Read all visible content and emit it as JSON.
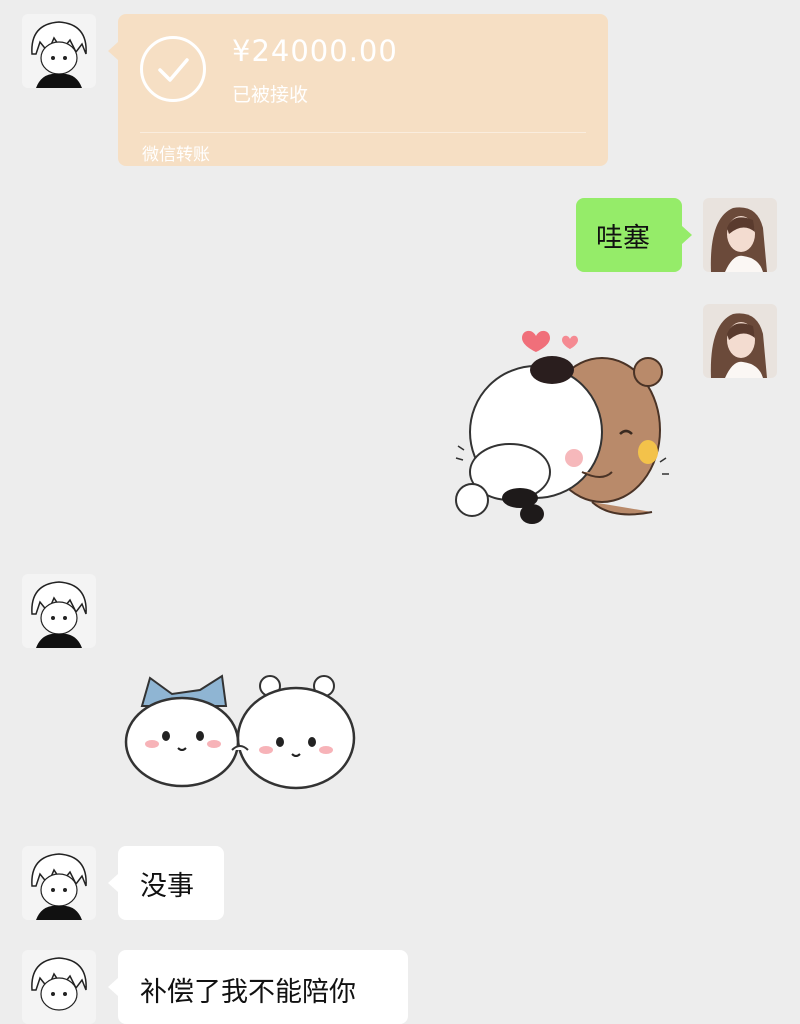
{
  "chat": {
    "messages": [
      {
        "sender": "other",
        "type": "transfer",
        "amount": "¥24000.00",
        "status": "已被接收",
        "label": "微信转账"
      },
      {
        "sender": "me",
        "type": "text",
        "text": "哇塞"
      },
      {
        "sender": "me",
        "type": "sticker",
        "sticker": "panda-bear-hug-sticker"
      },
      {
        "sender": "other",
        "type": "sticker",
        "sticker": "chiikawa-friends-sticker"
      },
      {
        "sender": "other",
        "type": "text",
        "text": "没事"
      },
      {
        "sender": "other",
        "type": "text",
        "text": "补偿了我不能陪你"
      }
    ]
  },
  "colors": {
    "background": "#ededed",
    "transfer_bubble": "#f6dfc4",
    "my_bubble": "#95ec69",
    "other_bubble": "#ffffff"
  }
}
